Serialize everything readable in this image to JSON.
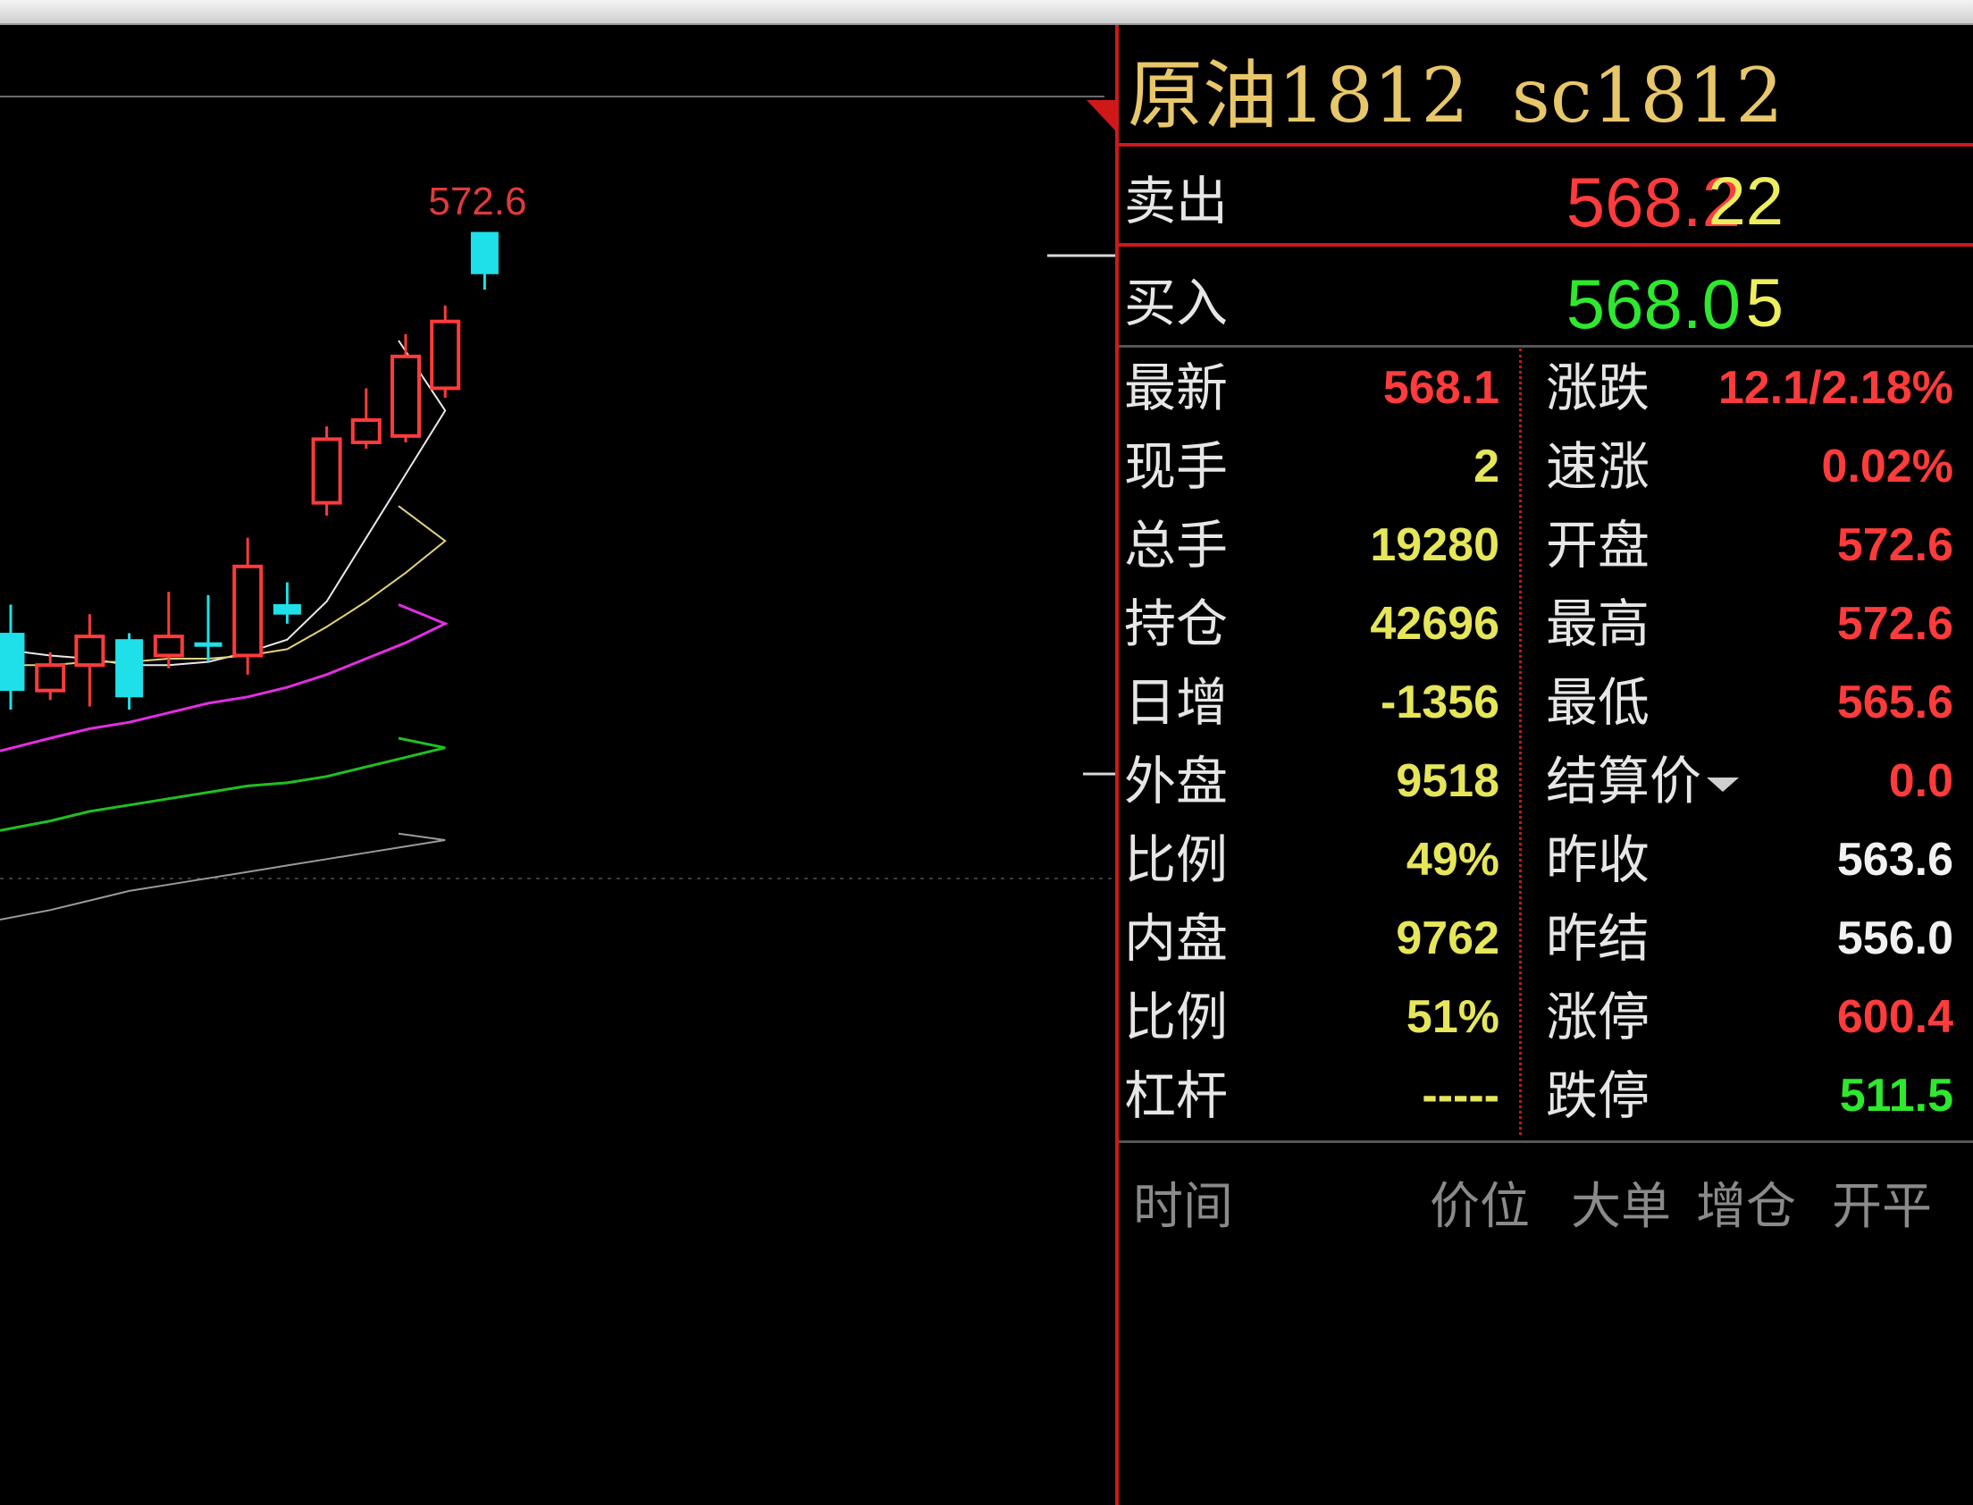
{
  "header": {
    "name": "原油1812",
    "code": "sc1812"
  },
  "order_book": {
    "sell": {
      "label": "卖出",
      "price": "568.2",
      "volume": "22"
    },
    "buy": {
      "label": "买入",
      "price": "568.0",
      "volume": "5"
    }
  },
  "stats": [
    {
      "label": "最新",
      "value": "568.1",
      "color": "#ff3b3b",
      "label2": "涨跌",
      "value2": "12.1/2.18%",
      "color2": "#ff3b3b"
    },
    {
      "label": "现手",
      "value": "2",
      "color": "#e6e65a",
      "label2": "速涨",
      "value2": "0.02%",
      "color2": "#ff3b3b"
    },
    {
      "label": "总手",
      "value": "19280",
      "color": "#e6e65a",
      "label2": "开盘",
      "value2": "572.6",
      "color2": "#ff3b3b"
    },
    {
      "label": "持仓",
      "value": "42696",
      "color": "#e6e65a",
      "label2": "最高",
      "value2": "572.6",
      "color2": "#ff3b3b"
    },
    {
      "label": "日增",
      "value": "-1356",
      "color": "#e6e65a",
      "label2": "最低",
      "value2": "565.6",
      "color2": "#ff3b3b"
    },
    {
      "label": "外盘",
      "value": "9518",
      "color": "#e6e65a",
      "label2": "结算价",
      "value2": "0.0",
      "color2": "#ff3b3b",
      "dropdown": true
    },
    {
      "label": "比例",
      "value": "49%",
      "color": "#e6e65a",
      "label2": "昨收",
      "value2": "563.6",
      "color2": "#f2f2f2"
    },
    {
      "label": "内盘",
      "value": "9762",
      "color": "#e6e65a",
      "label2": "昨结",
      "value2": "556.0",
      "color2": "#f2f2f2"
    },
    {
      "label": "比例",
      "value": "51%",
      "color": "#e6e65a",
      "label2": "涨停",
      "value2": "600.4",
      "color2": "#ff3b3b"
    },
    {
      "label": "杠杆",
      "value": "-----",
      "color": "#e6e65a",
      "label2": "跌停",
      "value2": "511.5",
      "color2": "#2ee82e"
    }
  ],
  "trades_header": {
    "time": "时间",
    "price": "价位",
    "big": "大单",
    "oi": "增仓",
    "open_close": "开平"
  },
  "chart": {
    "high_label": "572.6"
  },
  "colors": {
    "up": "#ff3b3b",
    "down": "#1fe0e8",
    "ma5": "#e8e8e8",
    "ma10": "#e2d27a",
    "ma20": "#e22ee2",
    "ma30": "#20c020",
    "ma60": "#9a9a9a",
    "divider": "#d01818"
  },
  "chart_data": {
    "type": "candlestick",
    "candles": [
      {
        "open": 560.0,
        "close": 558.2,
        "high": 560.9,
        "low": 557.6
      },
      {
        "open": 558.2,
        "close": 559.0,
        "high": 559.4,
        "low": 557.9
      },
      {
        "open": 559.0,
        "close": 559.9,
        "high": 560.6,
        "low": 557.7
      },
      {
        "open": 559.8,
        "close": 558.0,
        "high": 560.0,
        "low": 557.6
      },
      {
        "open": 559.3,
        "close": 559.9,
        "high": 561.3,
        "low": 558.9
      },
      {
        "open": 559.7,
        "close": 559.6,
        "high": 561.2,
        "low": 559.1
      },
      {
        "open": 559.3,
        "close": 562.1,
        "high": 563.0,
        "low": 558.7
      },
      {
        "open": 560.9,
        "close": 560.6,
        "high": 561.6,
        "low": 560.3
      },
      {
        "open": 564.1,
        "close": 566.1,
        "high": 566.5,
        "low": 563.7
      },
      {
        "open": 566.0,
        "close": 566.7,
        "high": 567.7,
        "low": 565.8
      },
      {
        "open": 566.2,
        "close": 568.7,
        "high": 569.4,
        "low": 566.0
      },
      {
        "open": 567.7,
        "close": 569.8,
        "high": 570.3,
        "low": 567.4
      },
      {
        "open": 572.6,
        "close": 571.3,
        "high": 572.6,
        "low": 570.8
      }
    ],
    "ma_lines": [
      {
        "name": "MA5",
        "values": [
          559.5,
          559.3,
          559.2,
          559.0,
          559.0,
          559.1,
          559.4,
          559.8,
          561.0,
          563.0,
          565.0,
          567.0,
          569.2
        ]
      },
      {
        "name": "MA10",
        "values": [
          559.0,
          559.0,
          559.1,
          559.1,
          559.2,
          559.2,
          559.3,
          559.5,
          560.2,
          561.0,
          561.9,
          562.9,
          564.0
        ]
      },
      {
        "name": "MA20",
        "values": [
          556.3,
          556.7,
          557.0,
          557.2,
          557.5,
          557.8,
          558.0,
          558.3,
          558.7,
          559.2,
          559.7,
          560.3,
          560.9
        ]
      },
      {
        "name": "MA30",
        "values": [
          553.8,
          554.1,
          554.4,
          554.6,
          554.8,
          555.0,
          555.2,
          555.3,
          555.5,
          555.8,
          556.1,
          556.4,
          556.7
        ]
      },
      {
        "name": "MA60",
        "values": [
          551.0,
          551.3,
          551.6,
          551.9,
          552.1,
          552.3,
          552.5,
          552.7,
          552.9,
          553.1,
          553.3,
          553.5,
          553.7
        ]
      }
    ],
    "high_marker": {
      "value": 572.6,
      "label": "572.6"
    }
  }
}
